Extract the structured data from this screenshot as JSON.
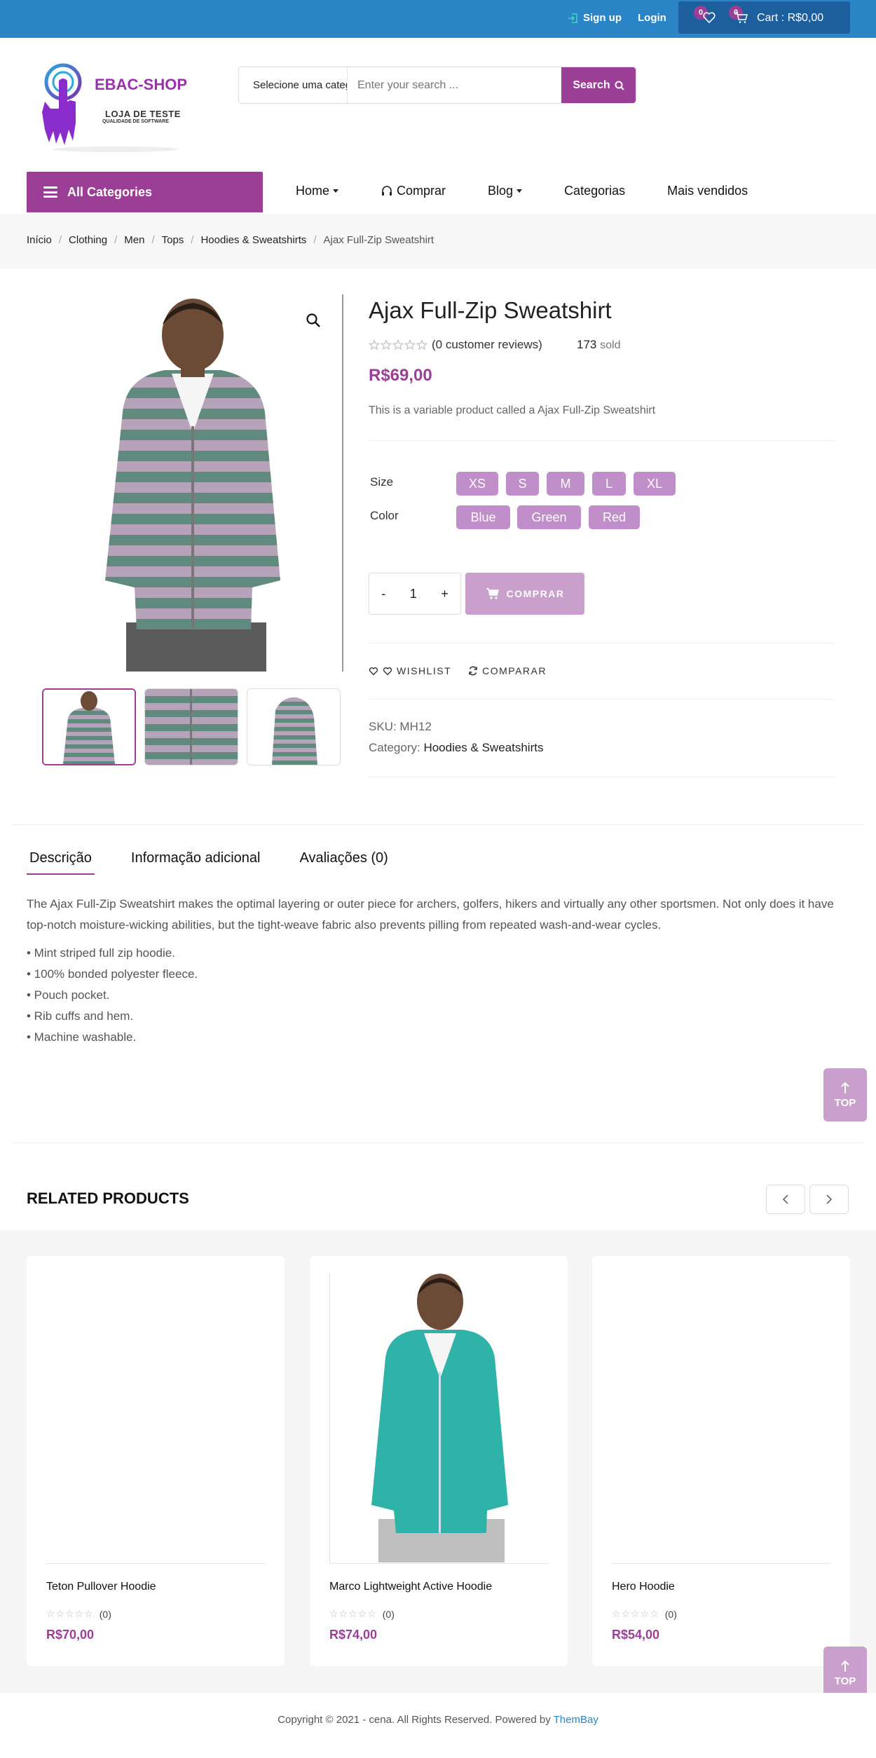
{
  "topbar": {
    "signup": "Sign up",
    "login": "Login",
    "wishlist_count": "0",
    "cart_count": "0",
    "cart_text": "Cart : R$0,00"
  },
  "header": {
    "logo_title": "EBAC-SHOP",
    "logo_subtitle": "LOJA DE TESTE",
    "logo_tagline": "QUALIDADE DE SOFTWARE",
    "search_category": "Selecione uma categoria",
    "search_placeholder": "Enter your search ...",
    "search_button": "Search"
  },
  "nav": {
    "all_categories": "All Categories",
    "items": [
      "Home",
      "Comprar",
      "Blog",
      "Categorias",
      "Mais vendidos"
    ]
  },
  "breadcrumb": [
    "Início",
    "Clothing",
    "Men",
    "Tops",
    "Hoodies & Sweatshirts",
    "Ajax Full-Zip Sweatshirt"
  ],
  "product": {
    "title": "Ajax Full-Zip Sweatshirt",
    "reviews": "(0 customer reviews)",
    "sold_count": "173",
    "sold_label": "sold",
    "price": "R$69,00",
    "short_description": "This is a variable product called a Ajax Full-Zip Sweatshirt",
    "size_label": "Size",
    "sizes": [
      "XS",
      "S",
      "M",
      "L",
      "XL"
    ],
    "color_label": "Color",
    "colors": [
      "Blue",
      "Green",
      "Red"
    ],
    "quantity": "1",
    "qty_minus": "-",
    "qty_plus": "+",
    "buy_button": "COMPRAR",
    "wishlist": "WISHLIST",
    "compare": "COMPARAR",
    "sku_label": "SKU:",
    "sku": "MH12",
    "category_label": "Category:",
    "category": "Hoodies & Sweatshirts"
  },
  "tabs": [
    "Descrição",
    "Informação adicional",
    "Avaliações (0)"
  ],
  "description": {
    "text": "The Ajax Full-Zip Sweatshirt makes the optimal layering or outer piece for archers, golfers, hikers and virtually any other sportsmen. Not only does it have top-notch moisture-wicking abilities, but the tight-weave fabric also prevents pilling from repeated wash-and-wear cycles.",
    "bullets": [
      "• Mint striped full zip hoodie.",
      "• 100% bonded polyester fleece.",
      "• Pouch pocket.",
      "• Rib cuffs and hem.",
      "• Machine washable."
    ]
  },
  "top_button": "TOP",
  "related": {
    "title": "RELATED PRODUCTS",
    "products": [
      {
        "name": "Teton Pullover Hoodie",
        "reviews": "(0)",
        "price": "R$70,00"
      },
      {
        "name": "Marco Lightweight Active Hoodie",
        "reviews": "(0)",
        "price": "R$74,00"
      },
      {
        "name": "Hero Hoodie",
        "reviews": "(0)",
        "price": "R$54,00"
      }
    ]
  },
  "footer": {
    "copyright": "Copyright © 2021 - cena. All Rights Reserved. Powered by",
    "powered": "ThemBay"
  },
  "colors": {
    "topbar": "#2b84c6",
    "brand_purple": "#9b3f96",
    "pill": "#c08ec8"
  }
}
